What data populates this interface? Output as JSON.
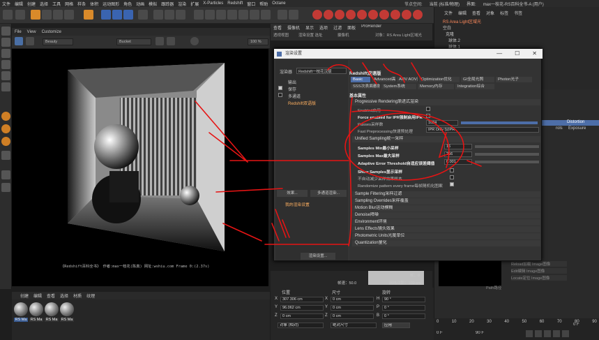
{
  "menubar": {
    "items": [
      "文件",
      "编辑",
      "创建",
      "选择",
      "工具",
      "网格",
      "样条",
      "体积",
      "运动图形",
      "角色",
      "动画",
      "模拟",
      "跟踪器",
      "渲染",
      "扩展",
      "X-Particles",
      "Redshift",
      "窗口",
      "帮助",
      "Octane"
    ],
    "layout_label": "节点空间:",
    "layout_value": "当前 (标准/物理)",
    "interface_label": "界面:",
    "interface_value": "max一枝花-RS百科全书-A (用户)"
  },
  "viewport": {
    "menu": [
      "File",
      "View",
      "Customize"
    ],
    "toolbar_dropdown_1": "Beauty",
    "toolbar_dropdown_2": "Bucket",
    "zoom": "100 %",
    "caption": "《Redshift百科全书》 作者:max一枝花(陈真) 网址:wshiu.com Frame 0:(2.37s)"
  },
  "material_manager": {
    "menu": [
      "创建",
      "编辑",
      "查看",
      "选择",
      "材质",
      "纹理"
    ],
    "materials": [
      "RS Ma",
      "RS Ma",
      "RS Ma",
      "RS Ma"
    ]
  },
  "mid_panel": {
    "top_tabs": [
      "查看",
      "摄像机",
      "显示",
      "选项",
      "过滤",
      "面板",
      "ProRender"
    ],
    "sub_tabs": [
      "透视视图",
      "渲染设置 选址"
    ],
    "camera_label": "摄像机",
    "object_label": "对象：RS Area Light区域光",
    "bottom_speed": "帧速：50.0",
    "bottom_grid": "网格间距：100 cm",
    "frame_label": "帧：0"
  },
  "dialog": {
    "title": "渲染设置",
    "controls": [
      "—",
      "☐",
      "✕"
    ],
    "renderer_label": "渲染器",
    "renderer_value": "Redshift一枝花汉版",
    "left_items": [
      "输出",
      "保存",
      "多通道",
      "Redshift双语版"
    ],
    "effects_button": "效果...",
    "multipass_button": "多通道渲染...",
    "my_settings": "我的渲染设置",
    "render_settings_button": "渲染设置...",
    "right_header": "Redshift双语版",
    "tabs_row1": [
      "Basic",
      "Advanced高级",
      "AOV AOV通道",
      "Optimization优化",
      "GI全局光照",
      "Photon光子"
    ],
    "tabs_row2": [
      "SSS次表面散射",
      "System系统",
      "Memory内存",
      "Integration综合"
    ],
    "section_basic": "基本属性",
    "progressive_header": "Progressive Rendering渐进式渲染",
    "enabled_label": "Enabled启用",
    "force_enabled_label": "Force enabled for IPR强制启用IPR",
    "passes_label": "Passes采样数",
    "passes_value": "1024",
    "fast_preprocessing_label": "Fast Preprocessing快速预处理",
    "fast_preprocessing_value": "IPR Only 仅IPR",
    "unified_header": "Unified Sampling统一采样",
    "samples_min_label": "Samples Min最小采样",
    "samples_min_value": "16",
    "samples_max_label": "Samples Max最大采样",
    "samples_max_value": "256",
    "adaptive_label": "Adaptive Error Threshold自适应误差阈值",
    "adaptive_value": "0.001",
    "show_samples_label": "Show Samples显示采样",
    "show_samples_sub": "不自动减少采样效果样本",
    "randomize_label": "Randomize pattern every frame每帧随机化图案",
    "collapsed_sections": [
      "Sample Filtering采样过滤",
      "Sampling Overrides采样覆盖",
      "Motion Blur运动模糊",
      "Denoise降噪",
      "Environment环境",
      "Lens Effects镜头效果",
      "Photometric Units光度单位",
      "Quantization量化"
    ],
    "annotation": "1.细节"
  },
  "object_manager": {
    "menu": [
      "文件",
      "编辑",
      "查看",
      "对象",
      "标签",
      "书签"
    ],
    "items": [
      "RS Area Light区域光",
      "空白",
      "克隆",
      "球体.2",
      "球体.1",
      "天空"
    ]
  },
  "attribute_manager": {
    "tabs": [
      "Distortion",
      "rols",
      "Exposure"
    ],
    "buttons": [
      "Reload加载 Image图像",
      "Edit编辑 Image图像",
      "Locate定位 Image图像"
    ],
    "path_label": "Path路径"
  },
  "coordinates": {
    "headers": [
      "位置",
      "尺寸",
      "旋转"
    ],
    "x_pos": "307.306 cm",
    "y_pos": "96.062 cm",
    "z_pos": "0 cm",
    "x_size": "0 cm",
    "y_size": "0 cm",
    "z_size": "0 cm",
    "h_rot": "90 °",
    "p_rot": "0 °",
    "b_rot": "0 °",
    "mode_1": "对象 (相对)",
    "mode_2": "绝对尺寸",
    "apply": "应用"
  },
  "timeline": {
    "ticks": [
      "0",
      "10",
      "20",
      "30",
      "40",
      "50",
      "60",
      "70",
      "80",
      "90"
    ],
    "start": "0 F",
    "end": "90 F",
    "current": "0 F"
  },
  "colors": {
    "accent": "#4d6ea8",
    "annotation": "#e61414",
    "highlight": "#d98a2a"
  }
}
